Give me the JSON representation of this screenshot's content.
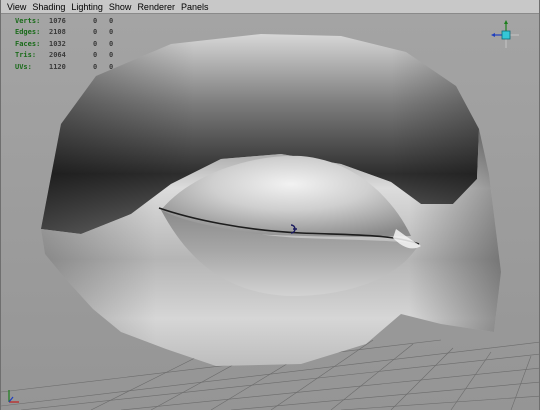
{
  "menu": [
    "View",
    "Shading",
    "Lighting",
    "Show",
    "Renderer",
    "Panels"
  ],
  "hud": [
    {
      "label": "Verts:",
      "values": [
        "1076",
        "0",
        "0"
      ]
    },
    {
      "label": "Edges:",
      "values": [
        "2108",
        "0",
        "0"
      ]
    },
    {
      "label": "Faces:",
      "values": [
        "1032",
        "0",
        "0"
      ]
    },
    {
      "label": "Tris:",
      "values": [
        "2064",
        "0",
        "0"
      ]
    },
    {
      "label": "UVs:",
      "values": [
        "1120",
        "0",
        "0"
      ]
    }
  ],
  "icons": {
    "view_cube": "view-axis-gizmo-icon",
    "origin": "origin-axis-icon",
    "pivot": "pivot-marker-icon"
  },
  "colors": {
    "viewport_bg": "#9d9d9d",
    "hud_label": "#1b6b1b",
    "hud_value": "#3a3a3a",
    "grid": "#6c6c6c"
  }
}
